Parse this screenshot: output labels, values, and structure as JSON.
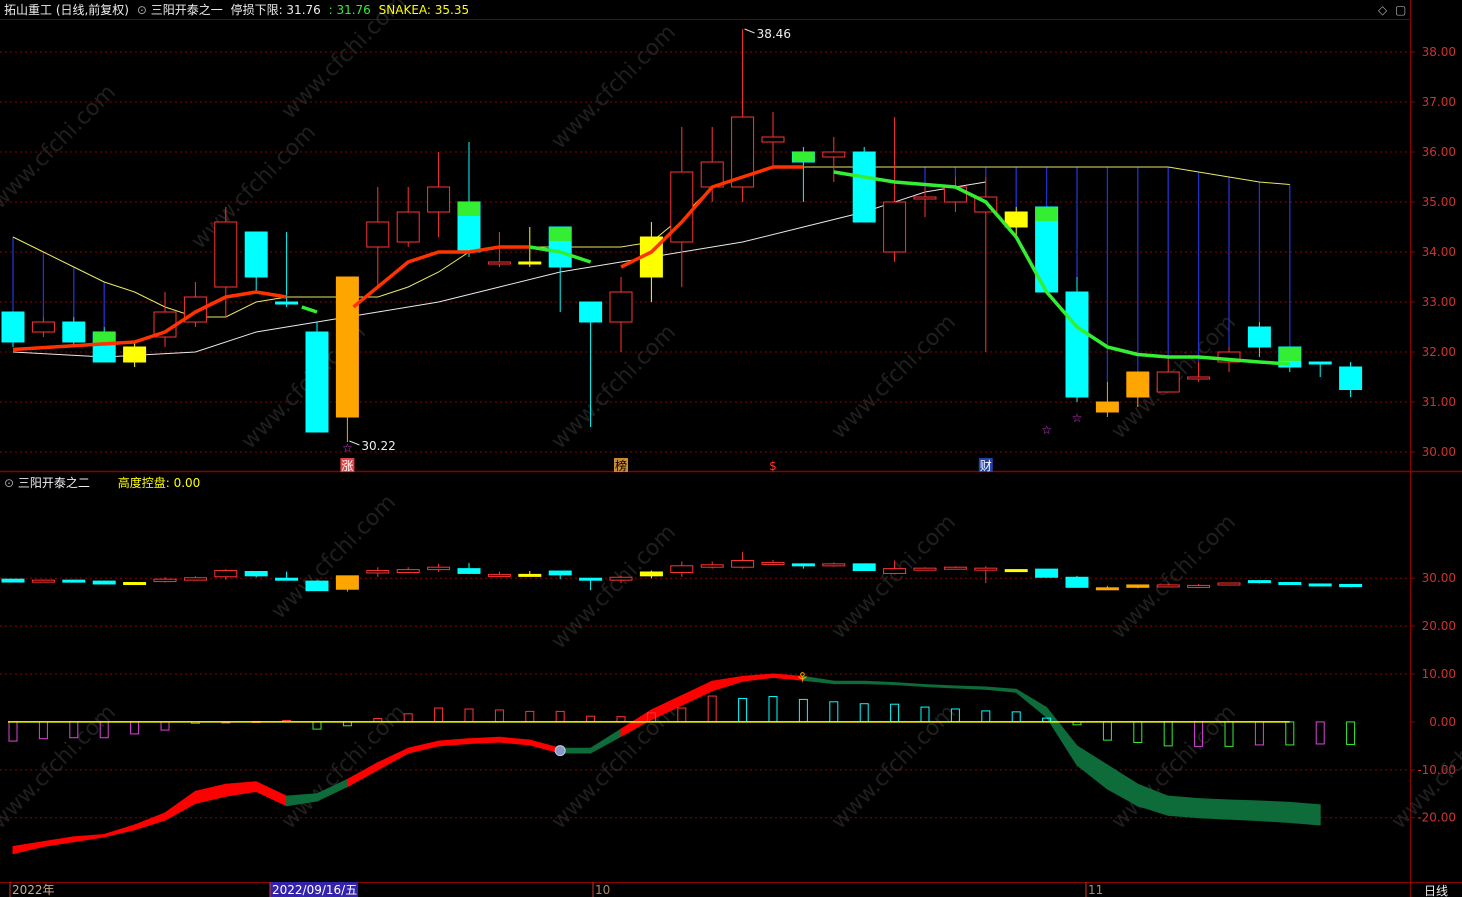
{
  "header": {
    "stock": "拓山重工 (日线,前复权)",
    "indicator": "三阳开泰之一",
    "stop_label": "停损下限: 31.76",
    "stop_value": ": 31.76",
    "snakea": "SNAKEA: 35.35"
  },
  "sub_header": {
    "indicator": "三阳开泰之二",
    "control_label": "高度控盘: 0.00"
  },
  "annotations": {
    "high_label": "38.46",
    "low_label": "30.22",
    "marks": [
      "涨",
      "榜",
      "$",
      "财"
    ]
  },
  "watermark": "www.cfchi.com",
  "x_axis": {
    "labels": [
      "2022年",
      "2022/09/16/五",
      "10",
      "11"
    ],
    "period": "日线"
  },
  "main_axis": {
    "ticks": [
      "38.00",
      "37.00",
      "36.00",
      "35.00",
      "34.00",
      "33.00",
      "32.00",
      "31.00",
      "30.00"
    ],
    "values": [
      38,
      37,
      36,
      35,
      34,
      33,
      32,
      31,
      30
    ]
  },
  "sub_axis": {
    "ticks": [
      "30.00",
      "20.00",
      "10.00",
      "0.00",
      "-10.00",
      "-20.00"
    ],
    "values": [
      30,
      20,
      10,
      0,
      -10,
      -20
    ]
  },
  "colors": {
    "up": "#ff3333",
    "down": "#00ffff",
    "green": "#33ee33",
    "yellow": "#ffff00",
    "orange": "#ffa500",
    "grid": "#8b0000",
    "blue": "#2233cc",
    "axis_text": "#cc3333"
  },
  "chart_data": {
    "type": "candlestick",
    "title": "拓山重工 (日线,前复权)",
    "y_range": [
      29.8,
      38.6
    ],
    "bars": [
      {
        "o": 32.8,
        "c": 32.2,
        "h": 32.8,
        "l": 32.1,
        "fill": "cyan"
      },
      {
        "o": 32.4,
        "c": 32.6,
        "h": 32.7,
        "l": 32.3,
        "fill": "hollow"
      },
      {
        "o": 32.6,
        "c": 32.2,
        "h": 32.7,
        "l": 32.1,
        "fill": "cyan"
      },
      {
        "o": 32.4,
        "c": 31.8,
        "h": 32.5,
        "l": 31.8,
        "fill": "cyan",
        "top": "green"
      },
      {
        "o": 32.1,
        "c": 31.8,
        "h": 32.2,
        "l": 31.7,
        "fill": "yellow"
      },
      {
        "o": 32.3,
        "c": 32.8,
        "h": 33.2,
        "l": 32.1,
        "fill": "hollow"
      },
      {
        "o": 32.6,
        "c": 33.1,
        "h": 33.4,
        "l": 32.5,
        "fill": "hollow"
      },
      {
        "o": 33.3,
        "c": 34.6,
        "h": 34.9,
        "l": 32.7,
        "fill": "hollow"
      },
      {
        "o": 34.4,
        "c": 33.5,
        "h": 34.4,
        "l": 33.2,
        "fill": "cyan"
      },
      {
        "o": 33.0,
        "c": 33.0,
        "h": 34.4,
        "l": 32.9,
        "fill": "cyan"
      },
      {
        "o": 32.4,
        "c": 30.4,
        "h": 32.6,
        "l": 30.4,
        "fill": "cyan"
      },
      {
        "o": 30.7,
        "c": 33.5,
        "h": 33.5,
        "l": 30.2,
        "fill": "orange"
      },
      {
        "o": 34.1,
        "c": 34.6,
        "h": 35.3,
        "l": 33.3,
        "fill": "hollow"
      },
      {
        "o": 34.2,
        "c": 34.8,
        "h": 35.3,
        "l": 34.1,
        "fill": "hollow"
      },
      {
        "o": 34.8,
        "c": 35.3,
        "h": 36.0,
        "l": 34.3,
        "fill": "hollow"
      },
      {
        "o": 35.0,
        "c": 34.0,
        "h": 36.2,
        "l": 33.9,
        "fill": "cyan",
        "top": "green"
      },
      {
        "o": 33.8,
        "c": 33.8,
        "h": 34.4,
        "l": 33.7,
        "fill": "hollow"
      },
      {
        "o": 33.8,
        "c": 33.8,
        "h": 34.5,
        "l": 33.7,
        "fill": "yellow"
      },
      {
        "o": 34.5,
        "c": 33.7,
        "h": 34.5,
        "l": 32.8,
        "fill": "cyan",
        "top": "green"
      },
      {
        "o": 33.0,
        "c": 32.6,
        "h": 33.0,
        "l": 30.5,
        "fill": "cyan"
      },
      {
        "o": 32.6,
        "c": 33.2,
        "h": 33.5,
        "l": 32.0,
        "fill": "hollow"
      },
      {
        "o": 33.5,
        "c": 34.3,
        "h": 34.6,
        "l": 33.0,
        "fill": "yellow"
      },
      {
        "o": 34.2,
        "c": 35.6,
        "h": 36.5,
        "l": 33.3,
        "fill": "hollow"
      },
      {
        "o": 35.3,
        "c": 35.8,
        "h": 36.5,
        "l": 35.0,
        "fill": "hollow"
      },
      {
        "o": 35.3,
        "c": 36.7,
        "h": 38.46,
        "l": 35.0,
        "fill": "hollow"
      },
      {
        "o": 36.2,
        "c": 36.3,
        "h": 36.8,
        "l": 35.7,
        "fill": "hollow"
      },
      {
        "o": 36.0,
        "c": 35.8,
        "h": 36.1,
        "l": 35.0,
        "fill": "cyan",
        "top": "green"
      },
      {
        "o": 35.9,
        "c": 36.0,
        "h": 36.3,
        "l": 35.4,
        "fill": "hollow"
      },
      {
        "o": 36.0,
        "c": 34.6,
        "h": 36.1,
        "l": 34.6,
        "fill": "cyan"
      },
      {
        "o": 34.0,
        "c": 35.0,
        "h": 36.7,
        "l": 33.8,
        "fill": "hollow"
      },
      {
        "o": 35.1,
        "c": 35.1,
        "h": 35.3,
        "l": 34.7,
        "fill": "hollow"
      },
      {
        "o": 35.0,
        "c": 35.3,
        "h": 35.5,
        "l": 34.8,
        "fill": "hollow"
      },
      {
        "o": 34.8,
        "c": 35.1,
        "h": 35.5,
        "l": 32.0,
        "fill": "hollow"
      },
      {
        "o": 34.8,
        "c": 34.5,
        "h": 34.9,
        "l": 34.3,
        "fill": "yellow"
      },
      {
        "o": 34.9,
        "c": 33.2,
        "h": 34.9,
        "l": 33.2,
        "fill": "cyan",
        "top": "green"
      },
      {
        "o": 33.2,
        "c": 31.1,
        "h": 33.5,
        "l": 31.0,
        "fill": "cyan"
      },
      {
        "o": 30.8,
        "c": 31.0,
        "h": 31.4,
        "l": 30.7,
        "fill": "orange"
      },
      {
        "o": 31.1,
        "c": 31.6,
        "h": 31.6,
        "l": 30.9,
        "fill": "orange"
      },
      {
        "o": 31.2,
        "c": 31.6,
        "h": 31.9,
        "l": 31.2,
        "fill": "hollow"
      },
      {
        "o": 31.5,
        "c": 31.5,
        "h": 31.8,
        "l": 31.4,
        "fill": "hollow"
      },
      {
        "o": 31.8,
        "c": 32.0,
        "h": 32.1,
        "l": 31.6,
        "fill": "hollow"
      },
      {
        "o": 32.5,
        "c": 32.1,
        "h": 32.6,
        "l": 31.9,
        "fill": "cyan"
      },
      {
        "o": 32.1,
        "c": 31.7,
        "h": 32.1,
        "l": 31.6,
        "fill": "cyan",
        "top": "green"
      },
      {
        "o": 31.8,
        "c": 31.8,
        "h": 31.8,
        "l": 31.5,
        "fill": "cyan"
      },
      {
        "o": 31.7,
        "c": 31.25,
        "h": 31.8,
        "l": 31.1,
        "fill": "cyan"
      }
    ],
    "stop_line": [
      {
        "i": 0,
        "v": 32.05,
        "c": "red"
      },
      {
        "i": 4,
        "v": 32.2,
        "c": "red"
      },
      {
        "i": 5,
        "v": 32.4,
        "c": "red"
      },
      {
        "i": 6,
        "v": 32.8,
        "c": "red"
      },
      {
        "i": 7,
        "v": 33.1,
        "c": "red"
      },
      {
        "i": 8,
        "v": 33.2,
        "c": "red"
      },
      {
        "i": 9,
        "v": 33.1,
        "c": "red",
        "break": true
      },
      {
        "i": 9.5,
        "v": 32.9,
        "c": "green"
      },
      {
        "i": 10,
        "v": 32.8,
        "c": "green",
        "break": true
      },
      {
        "i": 11.2,
        "v": 32.9,
        "c": "red"
      },
      {
        "i": 12,
        "v": 33.3,
        "c": "red"
      },
      {
        "i": 13,
        "v": 33.8,
        "c": "red"
      },
      {
        "i": 14,
        "v": 34.0,
        "c": "red"
      },
      {
        "i": 15,
        "v": 34.0,
        "c": "red"
      },
      {
        "i": 16,
        "v": 34.1,
        "c": "red"
      },
      {
        "i": 17,
        "v": 34.1,
        "c": "red"
      },
      {
        "i": 18,
        "v": 34.0,
        "c": "green"
      },
      {
        "i": 19,
        "v": 33.8,
        "c": "green",
        "break": true
      },
      {
        "i": 20,
        "v": 33.7,
        "c": "red"
      },
      {
        "i": 21,
        "v": 34.0,
        "c": "red"
      },
      {
        "i": 22,
        "v": 34.6,
        "c": "red"
      },
      {
        "i": 23,
        "v": 35.3,
        "c": "red"
      },
      {
        "i": 24,
        "v": 35.5,
        "c": "red"
      },
      {
        "i": 25,
        "v": 35.7,
        "c": "red"
      },
      {
        "i": 26,
        "v": 35.7,
        "c": "red",
        "break": true
      },
      {
        "i": 27,
        "v": 35.6,
        "c": "green"
      },
      {
        "i": 28,
        "v": 35.5,
        "c": "green"
      },
      {
        "i": 29,
        "v": 35.4,
        "c": "green"
      },
      {
        "i": 30,
        "v": 35.35,
        "c": "green"
      },
      {
        "i": 31,
        "v": 35.3,
        "c": "green"
      },
      {
        "i": 32,
        "v": 35.0,
        "c": "green"
      },
      {
        "i": 33,
        "v": 34.3,
        "c": "green"
      },
      {
        "i": 34,
        "v": 33.2,
        "c": "green"
      },
      {
        "i": 35,
        "v": 32.5,
        "c": "green"
      },
      {
        "i": 36,
        "v": 32.1,
        "c": "green"
      },
      {
        "i": 37,
        "v": 31.95,
        "c": "green"
      },
      {
        "i": 38,
        "v": 31.9,
        "c": "green"
      },
      {
        "i": 39,
        "v": 31.9,
        "c": "green"
      },
      {
        "i": 40,
        "v": 31.85,
        "c": "green"
      },
      {
        "i": 41,
        "v": 31.8,
        "c": "green"
      },
      {
        "i": 42,
        "v": 31.76,
        "c": "green"
      }
    ],
    "yellow_line": [
      [
        0,
        34.3
      ],
      [
        1,
        34.0
      ],
      [
        2,
        33.7
      ],
      [
        3,
        33.4
      ],
      [
        4,
        33.2
      ],
      [
        5,
        32.9
      ],
      [
        6,
        32.7
      ],
      [
        7,
        32.7
      ],
      [
        8,
        33.0
      ],
      [
        9,
        33.1
      ],
      [
        10,
        33.1
      ],
      [
        11,
        33.1
      ],
      [
        12,
        33.1
      ],
      [
        13,
        33.3
      ],
      [
        14,
        33.6
      ],
      [
        15,
        34.0
      ],
      [
        16,
        34.1
      ],
      [
        17,
        34.1
      ],
      [
        18,
        34.1
      ],
      [
        19,
        34.1
      ],
      [
        20,
        34.1
      ],
      [
        21,
        34.2
      ],
      [
        22,
        34.7
      ],
      [
        23,
        35.3
      ],
      [
        24,
        35.5
      ],
      [
        25,
        35.7
      ],
      [
        26,
        35.7
      ],
      [
        27,
        35.7
      ],
      [
        28,
        35.7
      ],
      [
        29,
        35.7
      ],
      [
        30,
        35.7
      ],
      [
        31,
        35.7
      ],
      [
        32,
        35.7
      ],
      [
        33,
        35.7
      ],
      [
        34,
        35.7
      ],
      [
        35,
        35.7
      ],
      [
        36,
        35.7
      ],
      [
        37,
        35.7
      ],
      [
        38,
        35.7
      ],
      [
        39,
        35.6
      ],
      [
        40,
        35.5
      ],
      [
        41,
        35.4
      ],
      [
        42,
        35.35
      ]
    ],
    "white_line": [
      [
        0,
        32.0
      ],
      [
        3,
        31.9
      ],
      [
        6,
        32.0
      ],
      [
        8,
        32.4
      ],
      [
        10,
        32.6
      ],
      [
        12,
        32.8
      ],
      [
        14,
        33.0
      ],
      [
        16,
        33.3
      ],
      [
        18,
        33.6
      ],
      [
        20,
        33.8
      ],
      [
        22,
        34.0
      ],
      [
        24,
        34.2
      ],
      [
        26,
        34.5
      ],
      [
        28,
        34.8
      ],
      [
        30,
        35.2
      ],
      [
        32,
        35.4
      ]
    ],
    "blue_sticks": [
      0,
      1,
      2,
      3,
      30,
      31,
      32,
      33,
      34,
      35,
      36,
      37,
      38,
      39,
      40,
      41,
      42
    ],
    "sub": {
      "y_range": [
        -33,
        48
      ],
      "mini_offset": -3,
      "histogram": [
        -4,
        -3.5,
        -3.3,
        -3.3,
        -2.5,
        -1.7,
        -0.3,
        -0.2,
        0.1,
        0.3,
        -1.5,
        -0.8,
        0.7,
        1.7,
        2.9,
        2.7,
        2.5,
        2.2,
        2.2,
        1.2,
        1.1,
        1.9,
        2.9,
        5.4,
        4.9,
        5.3,
        4.7,
        4.2,
        3.8,
        3.7,
        3.1,
        2.7,
        2.3,
        2.1,
        0.8,
        -0.6,
        -3.8,
        -4.3,
        -5.0,
        -5.1,
        -5.1,
        -4.8,
        -4.8,
        -4.6,
        -4.7
      ],
      "band_upper": [
        -26,
        -25,
        -24,
        -23.5,
        -21.5,
        -19,
        -14.5,
        -13,
        -12.5,
        -15.5,
        -15,
        -12,
        -8.5,
        -5.5,
        -4,
        -3.5,
        -3.2,
        -3.8,
        -5.5,
        -5.5,
        -1.5,
        2.5,
        5.5,
        8.5,
        9.5,
        10,
        9.5,
        8.5,
        8.5,
        8.2,
        7.8,
        7.5,
        7.3,
        6.8,
        3,
        -5,
        -9,
        -13,
        -15.5,
        -16,
        -16.3,
        -16.5,
        -16.8,
        -17.3
      ],
      "band_lower": [
        -27.5,
        -26,
        -25,
        -24,
        -22.5,
        -20.5,
        -17,
        -15.5,
        -14.5,
        -17.5,
        -16.5,
        -13.5,
        -10,
        -6.5,
        -5,
        -4.5,
        -4.2,
        -4.8,
        -6.5,
        -6.5,
        -3,
        0.5,
        3.5,
        6.5,
        8.5,
        9.3,
        8.7,
        8,
        8,
        7.8,
        7.4,
        7.1,
        6.8,
        6.2,
        1,
        -9,
        -14,
        -17.5,
        -19.5,
        -20,
        -20.3,
        -20.6,
        -21,
        -21.5
      ],
      "band_colors": [
        "red",
        "red",
        "red",
        "red",
        "red",
        "red",
        "red",
        "red",
        "red",
        "green",
        "green",
        "red",
        "red",
        "red",
        "red",
        "red",
        "red",
        "red",
        "green",
        "green",
        "red",
        "red",
        "red",
        "red",
        "red",
        "red",
        "green",
        "green",
        "green",
        "green",
        "green",
        "green",
        "green",
        "green",
        "green",
        "green",
        "green",
        "green",
        "green",
        "green",
        "green",
        "green",
        "green",
        "green"
      ]
    }
  }
}
